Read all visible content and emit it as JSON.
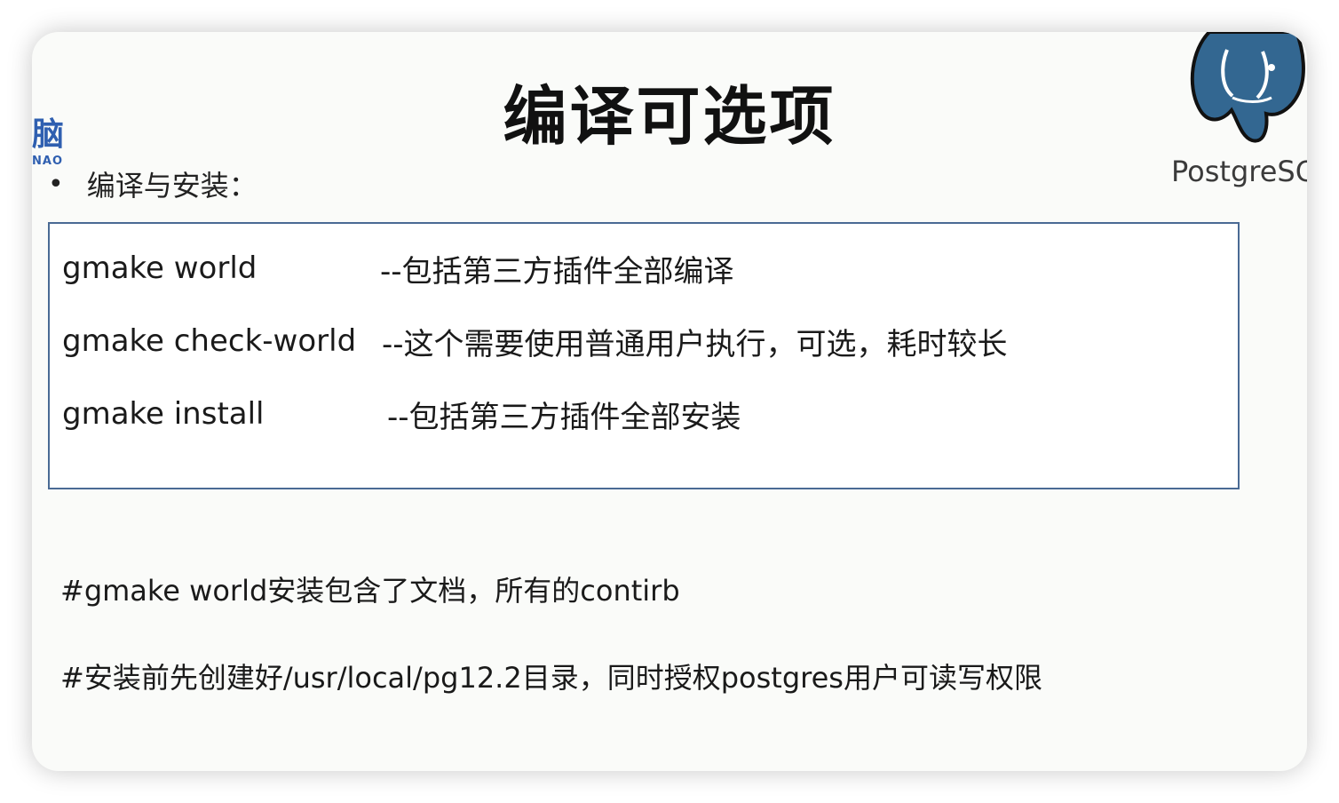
{
  "slide": {
    "title": "编译可选项",
    "brand_left": {
      "glyph": "脑",
      "sub": "NAO"
    },
    "brand_right": {
      "text": "PostgreSQ"
    },
    "bullet": {
      "label": "编译与安装："
    },
    "commands": [
      {
        "cmd": "gmake world",
        "desc": "--包括第三方插件全部编译"
      },
      {
        "cmd": "gmake check-world",
        "desc": "--这个需要使用普通用户执行，可选，耗时较长"
      },
      {
        "cmd": "gmake install",
        "desc": "--包括第三方插件全部安装"
      }
    ],
    "notes": [
      "#gmake world安装包含了文档，所有的contirb",
      "#安装前先创建好/usr/local/pg12.2目录，同时授权postgres用户可读写权限"
    ]
  },
  "colors": {
    "card_bg": "#fafbf9",
    "box_border": "#4a6a94",
    "brand_blue": "#2f5fb0",
    "elephant_blue": "#336791"
  },
  "icons": {
    "logo_right": "postgresql-elephant-icon"
  }
}
